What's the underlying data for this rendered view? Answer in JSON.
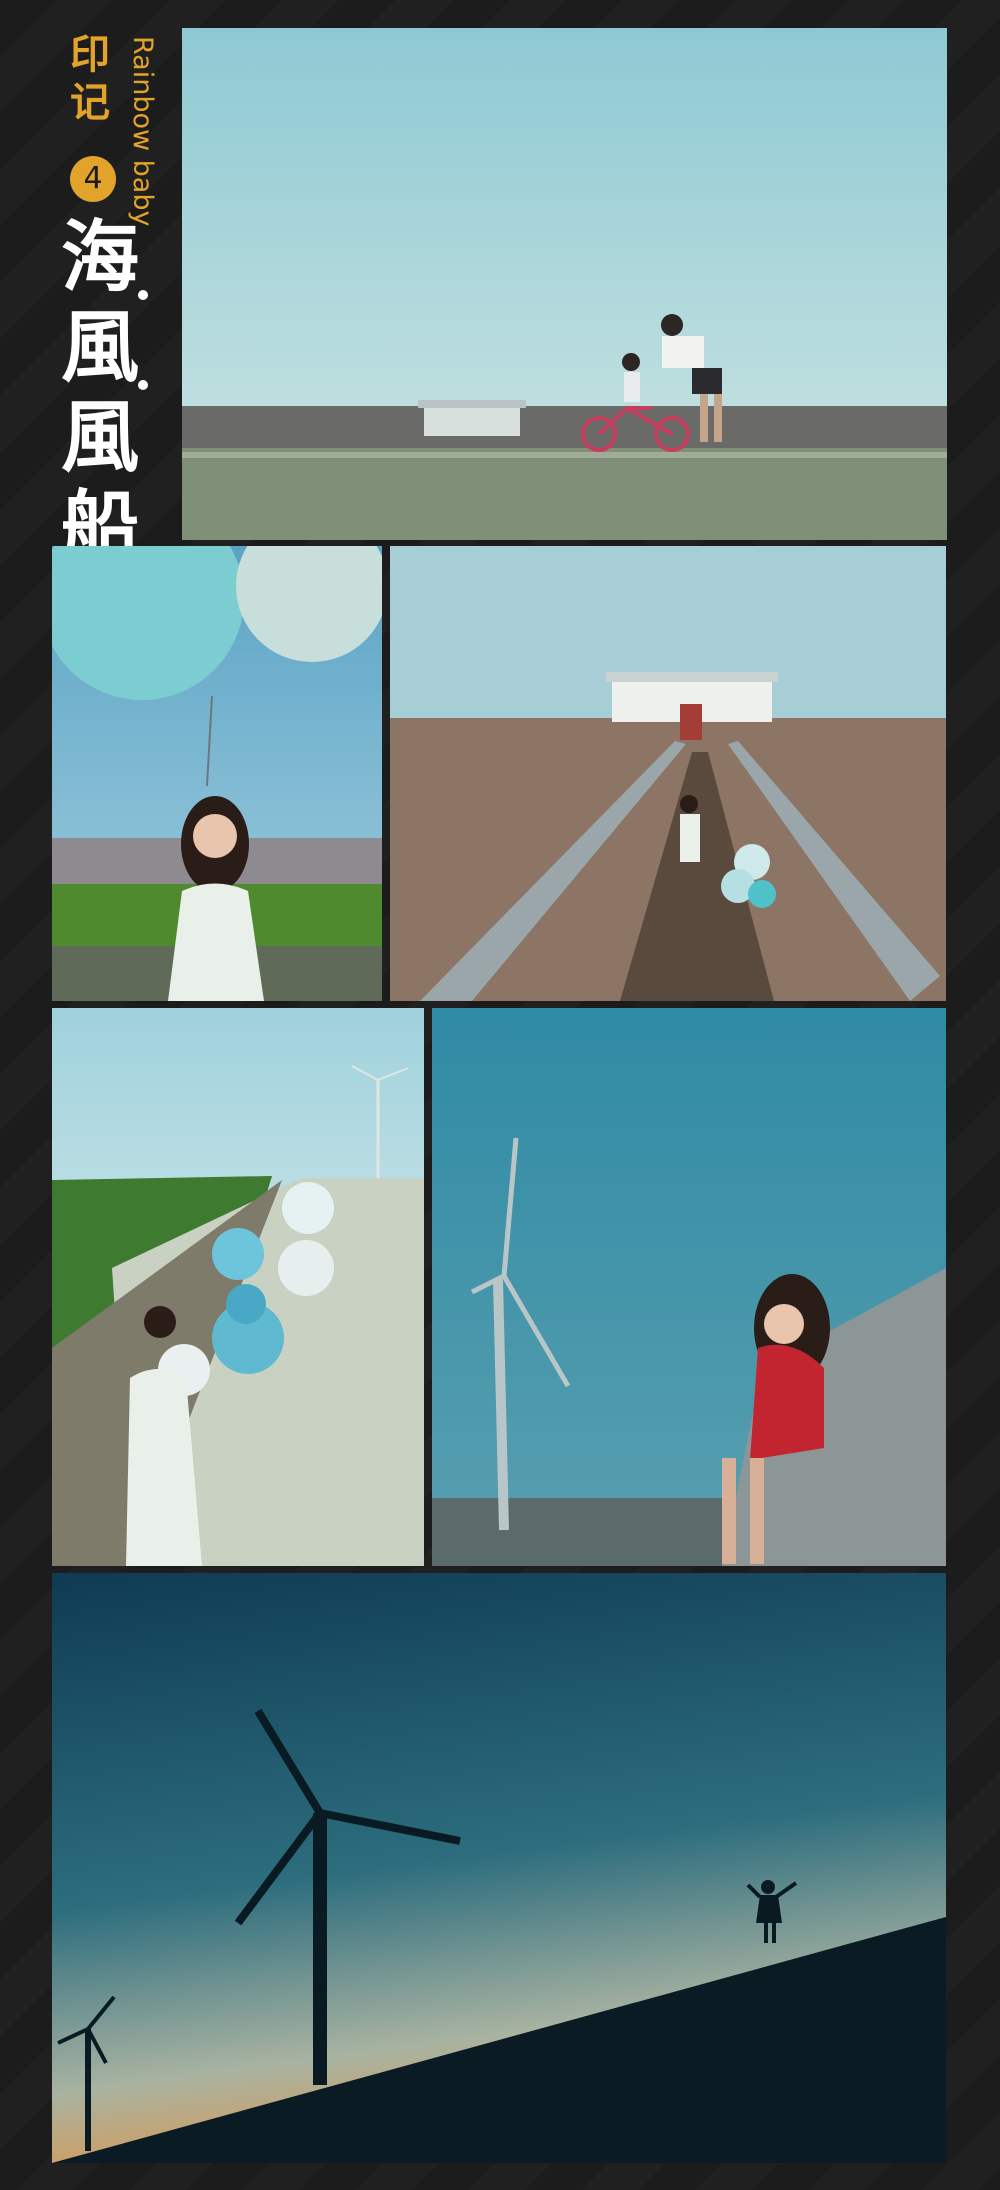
{
  "title": {
    "line1_char1": "印",
    "line1_char2": "记",
    "number": "4",
    "english": "Rainbow baby",
    "main_chars": [
      "海",
      "風",
      "風",
      "船"
    ]
  },
  "colors": {
    "background": "#1b1b1c",
    "accent": "#e1a32a",
    "title_white": "#ffffff"
  },
  "photos": [
    {
      "name": "photo-sea-bike",
      "subject": "father-and-daughter-on-bicycle-by-sea"
    },
    {
      "name": "photo-balloon-girl-grass",
      "subject": "girl-with-balloon-by-grass"
    },
    {
      "name": "photo-pier-girl",
      "subject": "girl-with-balloons-on-pier"
    },
    {
      "name": "photo-road-balloons",
      "subject": "girl-walking-road-with-balloons"
    },
    {
      "name": "photo-red-dress-turbine",
      "subject": "girl-in-red-dress-with-wind-turbine"
    },
    {
      "name": "photo-silhouette-sunset",
      "subject": "silhouette-with-wind-turbines-at-dusk"
    }
  ]
}
